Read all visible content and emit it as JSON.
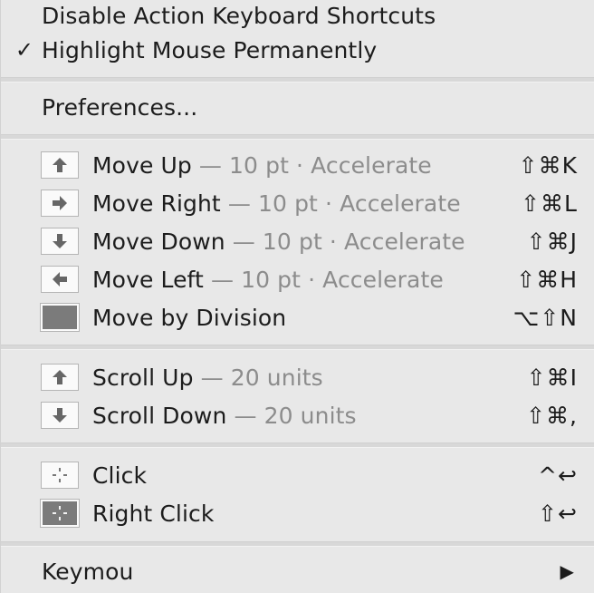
{
  "menu": {
    "top_items": [
      {
        "label": "Disable Action Keyboard Shortcuts",
        "checked": ""
      },
      {
        "label": "Highlight Mouse Permanently",
        "checked": "✓"
      }
    ],
    "preferences_label": "Preferences...",
    "move_items": [
      {
        "label": "Move Up",
        "detail": " — 10 pt · Accelerate",
        "shortcut": "⇧⌘K",
        "icon": "arrow-up-icon"
      },
      {
        "label": "Move Right",
        "detail": " — 10 pt · Accelerate",
        "shortcut": "⇧⌘L",
        "icon": "arrow-right-icon"
      },
      {
        "label": "Move Down",
        "detail": " — 10 pt · Accelerate",
        "shortcut": "⇧⌘J",
        "icon": "arrow-down-icon"
      },
      {
        "label": "Move Left",
        "detail": " — 10 pt · Accelerate",
        "shortcut": "⇧⌘H",
        "icon": "arrow-left-icon"
      },
      {
        "label": "Move by Division",
        "detail": "",
        "shortcut": "⌥⇧N",
        "icon": "division-icon"
      }
    ],
    "scroll_items": [
      {
        "label": "Scroll Up",
        "detail": " — 20 units",
        "shortcut": "⇧⌘I",
        "icon": "arrow-up-icon"
      },
      {
        "label": "Scroll Down",
        "detail": " — 20 units",
        "shortcut": "⇧⌘,",
        "icon": "arrow-down-icon"
      }
    ],
    "click_items": [
      {
        "label": "Click",
        "shortcut": "^↩",
        "icon": "click-icon"
      },
      {
        "label": "Right Click",
        "shortcut": "⇧↩",
        "icon": "right-click-icon"
      }
    ],
    "keymou_label": "Keymou",
    "keymou_submenu_glyph": "▶"
  },
  "colors": {
    "menu_bg": "#e8e8e8",
    "muted_text": "#8c8c8c",
    "text": "#1c1c1c"
  }
}
